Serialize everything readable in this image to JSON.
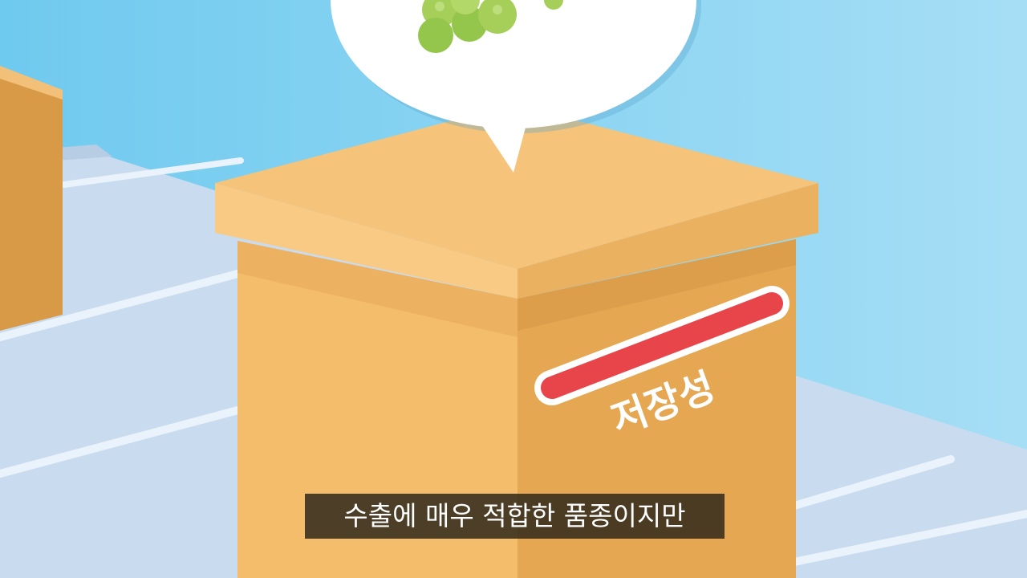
{
  "box_label": "저장성",
  "subtitle": "수출에 매우 적합한 품종이지만",
  "colors": {
    "sky_top": "#6fcaef",
    "sky_bottom": "#a6def5",
    "belt": "#c9dcef",
    "belt_stripe": "#eaf3fb",
    "box_lid": "#f6c37a",
    "box_front": "#f4bd6b",
    "box_side": "#e6a752",
    "label_bar": "#e8454a",
    "grape": "#95c64c",
    "bubble": "#ffffff"
  }
}
